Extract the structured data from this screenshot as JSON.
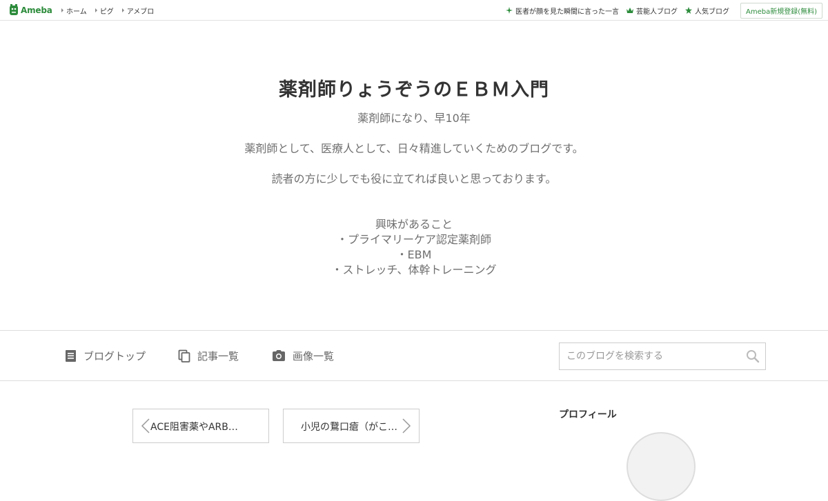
{
  "global_header": {
    "logo_text": "Ameba",
    "nav": [
      "ホーム",
      "ピグ",
      "アメブロ"
    ],
    "right_links": [
      {
        "label": "医者が顔を見た瞬間に言った一言",
        "icon": "sparkle-icon"
      },
      {
        "label": "芸能人ブログ",
        "icon": "crown-icon"
      },
      {
        "label": "人気ブログ",
        "icon": "star-icon"
      }
    ],
    "signup": "Ameba新規登録(無料)"
  },
  "blog": {
    "title": "薬剤師りょうぞうのＥＢＭ入門",
    "description": [
      "薬剤師になり、早10年",
      "薬剤師として、医療人として、日々精進していくためのブログです。",
      "読者の方に少しでも役に立てれば良いと思っております。",
      "興味があること",
      "・プライマリーケア認定薬剤師",
      "・EBM",
      "・ストレッチ、体幹トレーニング"
    ]
  },
  "blog_nav": {
    "items": [
      "ブログトップ",
      "記事一覧",
      "画像一覧"
    ],
    "search_placeholder": "このブログを検索する"
  },
  "pager": {
    "prev": "ACE阻害薬やARBは…",
    "next": "小児の鵞口瘡（がこ…"
  },
  "sidebar": {
    "profile_title": "プロフィール"
  },
  "colors": {
    "brand_green": "#2d8c3c",
    "text_gray": "#707070"
  }
}
